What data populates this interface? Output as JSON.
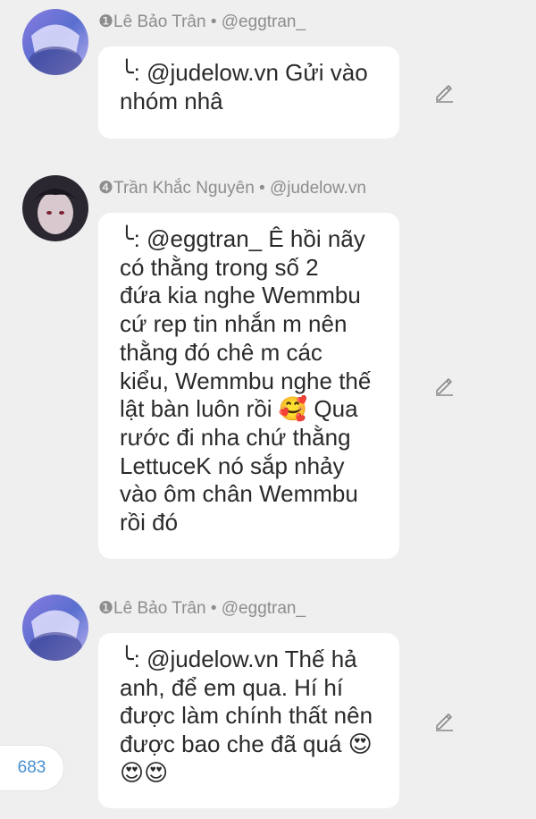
{
  "comments": [
    {
      "level": "❶",
      "author": "Lê Bảo Trân • @eggtran_",
      "message": "╰: @judelow.vn Gửi vào\nnhóm nhâ"
    },
    {
      "level": "❹",
      "author": "Trần Khắc Nguyên • @judelow.vn",
      "message": "╰: @eggtran_ Ê hồi nãy\ncó thằng trong số 2\nđứa kia nghe Wemmbu\ncứ rep tin nhắn m nên\nthằng đó chê m các\nkiểu, Wemmbu nghe thế\nlật bàn luôn rồi 🥰 Qua\nrước đi nha chứ thằng\nLettuceK nó sắp nhảy\nvào ôm chân Wemmbu\nrồi đó"
    },
    {
      "level": "❶",
      "author": "Lê Bảo Trân • @eggtran_",
      "message": "╰: @judelow.vn Thế hả\nanh, để em qua. Hí hí\nđược làm chính thất nên\nđược bao che đã quá 😍\n😍😍"
    }
  ],
  "counter": "683",
  "icons": {
    "edit": "pencil-edit-icon",
    "avatar": "avatar-image"
  },
  "colors": {
    "background": "#efefef",
    "bubble": "#ffffff",
    "meta_text": "#8d8d8d",
    "counter_text": "#4a8fd0"
  }
}
